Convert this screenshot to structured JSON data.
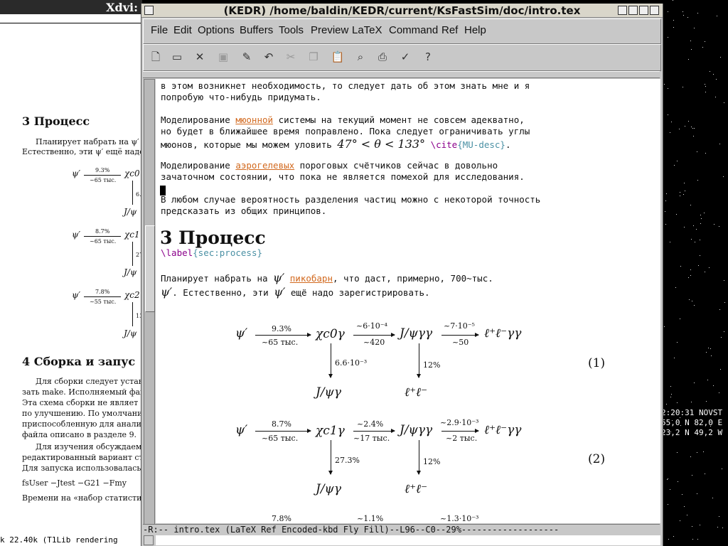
{
  "xdvi": {
    "title": "Xdvi:",
    "section3_heading": "3   Процесс",
    "section3_line1": "Планирует набрать на ψ′ п",
    "section3_line2": "Естественно, эти ψ′ ещё надо",
    "diagram1": {
      "a": "ψ′",
      "top": "9.3%",
      "bottom": "~65 тыс.",
      "b": "χc0",
      "side": "6.",
      "c": "J/ψ"
    },
    "diagram2": {
      "a": "ψ′",
      "top": "8.7%",
      "bottom": "~65 тыс.",
      "b": "χc1",
      "side": "27",
      "c": "J/ψ"
    },
    "diagram3": {
      "a": "ψ′",
      "top": "7.8%",
      "bottom": "~55 тыс.",
      "b": "χc2",
      "side": "13",
      "c": "J/ψ"
    },
    "section4_heading": "4   Сборка и запус",
    "section4_lines": [
      "Для сборки следует устан",
      "зать make. Исполняемый фай",
      "Эта схема сборки не являет",
      "по улучшению. По умолчани",
      "приспособленную для анализ",
      "файла описано в разделе 9.",
      "Для изучения обсуждаемо",
      "редактированный вариант ста",
      "Для запуска использовалась с"
    ],
    "command_line": "fsUser −Jtest −G21 −Fmy",
    "last_line": "Времени на «набор статистик",
    "status": "k 22.40k  (T1Lib rendering"
  },
  "terminal": {
    "lines": [
      "2:20:31 NOVST",
      "55,0 N 82,0 E",
      "23,2 N 49,2 W"
    ]
  },
  "emacs": {
    "title": "(KEDR) /home/baldin/KEDR/current/KsFastSim/doc/intro.tex",
    "menu": [
      "File",
      "Edit",
      "Options",
      "Buffers",
      "Tools",
      "Preview",
      "LaTeX",
      "Command",
      "Ref",
      "Help"
    ],
    "text": {
      "l1": "в этом возникнет необходимость, то следует дать об этом знать мне и я",
      "l2": "попробую что-нибудь придумать.",
      "l3_pre": "Моделирование ",
      "l3_link": "мюонной",
      "l3_post": " системы на текущий момент не совсем адекватно,",
      "l4": "но будет в ближайшее время поправлено. Пока следует ограничивать углы",
      "l5_pre": "мюонов, которые мы можем уловить ",
      "l5_math": "47° < θ < 133°",
      "l5_cmd": "\\cite",
      "l5_arg": "{MU-desc}",
      "l5_end": ".",
      "l6_pre": "Моделирование ",
      "l6_link": "аэрогелевых",
      "l6_post": " пороговых счётчиков сейчас в довольно",
      "l7": "зачаточном состоянии, что пока не является помехой для исследования.",
      "l8": "В любом случае вероятность разделения частиц можно с некоторой точность",
      "l9": "предсказать из общих принципов.",
      "heading": "3   Процесс",
      "label_cmd": "\\label",
      "label_arg": "{sec:process}",
      "p1_pre": "Планирует набрать на ",
      "p1_psi": "ψ′",
      "p1_link": "пикобарн",
      "p1_post": ", что даст, примерно, 700~тыс.",
      "p2_psi": "ψ′",
      "p2_mid": ". Естественно, эти ",
      "p2_psi2": "ψ′",
      "p2_post": " ещё надо зарегистрировать."
    },
    "eq1": {
      "psi": "ψ′",
      "t1": "9.3%",
      "b1": "~65 тыс.",
      "chi": "χc0γ",
      "t2": "~6·10⁻⁴",
      "b2": "~420",
      "jpsi": "J/ψγγ",
      "t3": "~7·10⁻⁵",
      "b3": "~50",
      "end": "ℓ⁺ℓ⁻γγ",
      "v1": "6.6·10⁻³",
      "d1": "J/ψγ",
      "v2": "12%",
      "d2": "ℓ⁺ℓ⁻",
      "num": "(1)"
    },
    "eq2": {
      "psi": "ψ′",
      "t1": "8.7%",
      "b1": "~65 тыс.",
      "chi": "χc1γ",
      "t2": "~2.4%",
      "b2": "~17 тыс.",
      "jpsi": "J/ψγγ",
      "t3": "~2.9·10⁻³",
      "b3": "~2 тыс.",
      "end": "ℓ⁺ℓ⁻γγ",
      "v1": "27.3%",
      "d1": "J/ψγ",
      "v2": "12%",
      "d2": "ℓ⁺ℓ⁻",
      "num": "(2)"
    },
    "eq3": {
      "t1": "7.8%",
      "t2": "~1.1%",
      "t3": "~1.3·10⁻³"
    },
    "modeline": "-R:--  intro.tex      (LaTeX Ref Encoded-kbd Fly Fill)--L96--C0--29%-------------------"
  }
}
